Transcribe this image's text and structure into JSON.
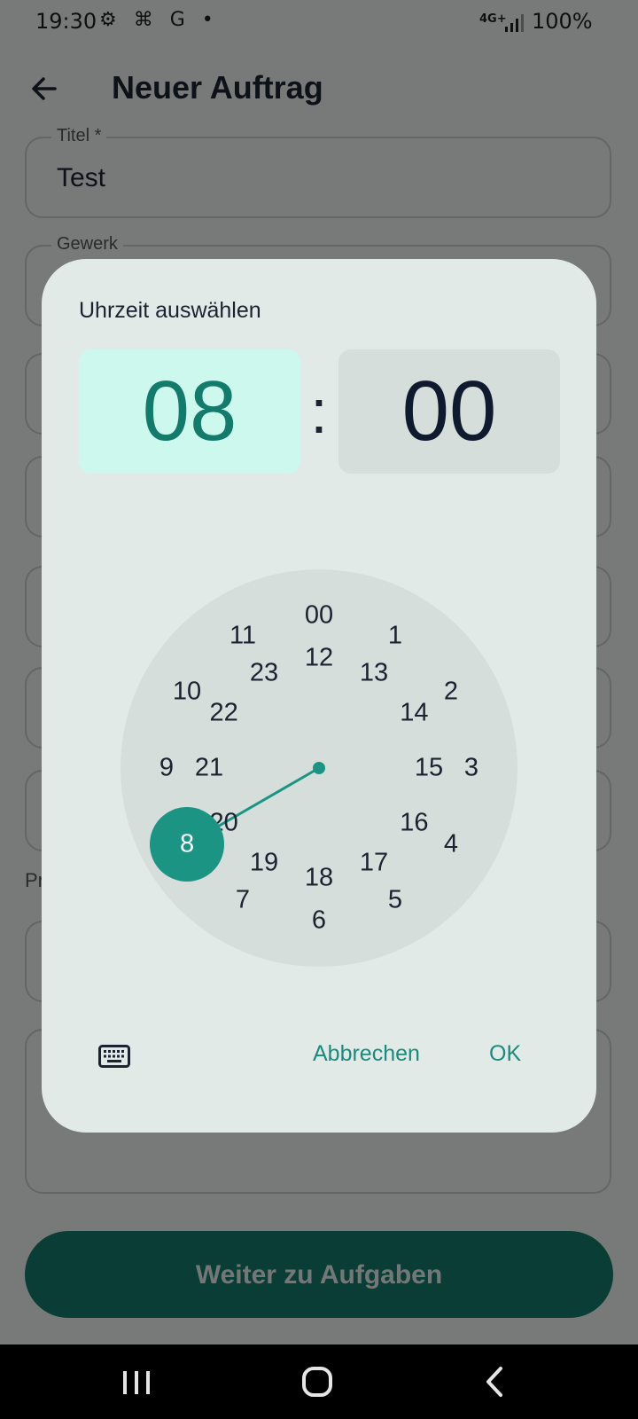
{
  "status_bar": {
    "time": "19:30",
    "network": "4G+",
    "battery": "100%"
  },
  "app_bar": {
    "title": "Neuer Auftrag"
  },
  "form": {
    "title_label": "Titel *",
    "title_value": "Test",
    "trade_label": "Gewerk",
    "pr_label": "Pr",
    "continue_button": "Weiter zu Aufgaben"
  },
  "dialog": {
    "title": "Uhrzeit auswählen",
    "hour": "08",
    "separator": ":",
    "minute": "00",
    "selected_value": "8",
    "outer_ring": [
      "00",
      "1",
      "2",
      "3",
      "4",
      "5",
      "6",
      "7",
      "8",
      "9",
      "10",
      "11"
    ],
    "inner_ring": [
      "12",
      "13",
      "14",
      "15",
      "16",
      "17",
      "18",
      "19",
      "20",
      "21",
      "22",
      "23"
    ],
    "cancel_button": "Abbrechen",
    "ok_button": "OK"
  },
  "colors": {
    "accent": "#1b9484",
    "accent_text": "#1a8b7c",
    "hour_bg": "#cdf8ee",
    "dialog_bg": "#e2eae8",
    "dial_bg": "#d6dedb"
  }
}
